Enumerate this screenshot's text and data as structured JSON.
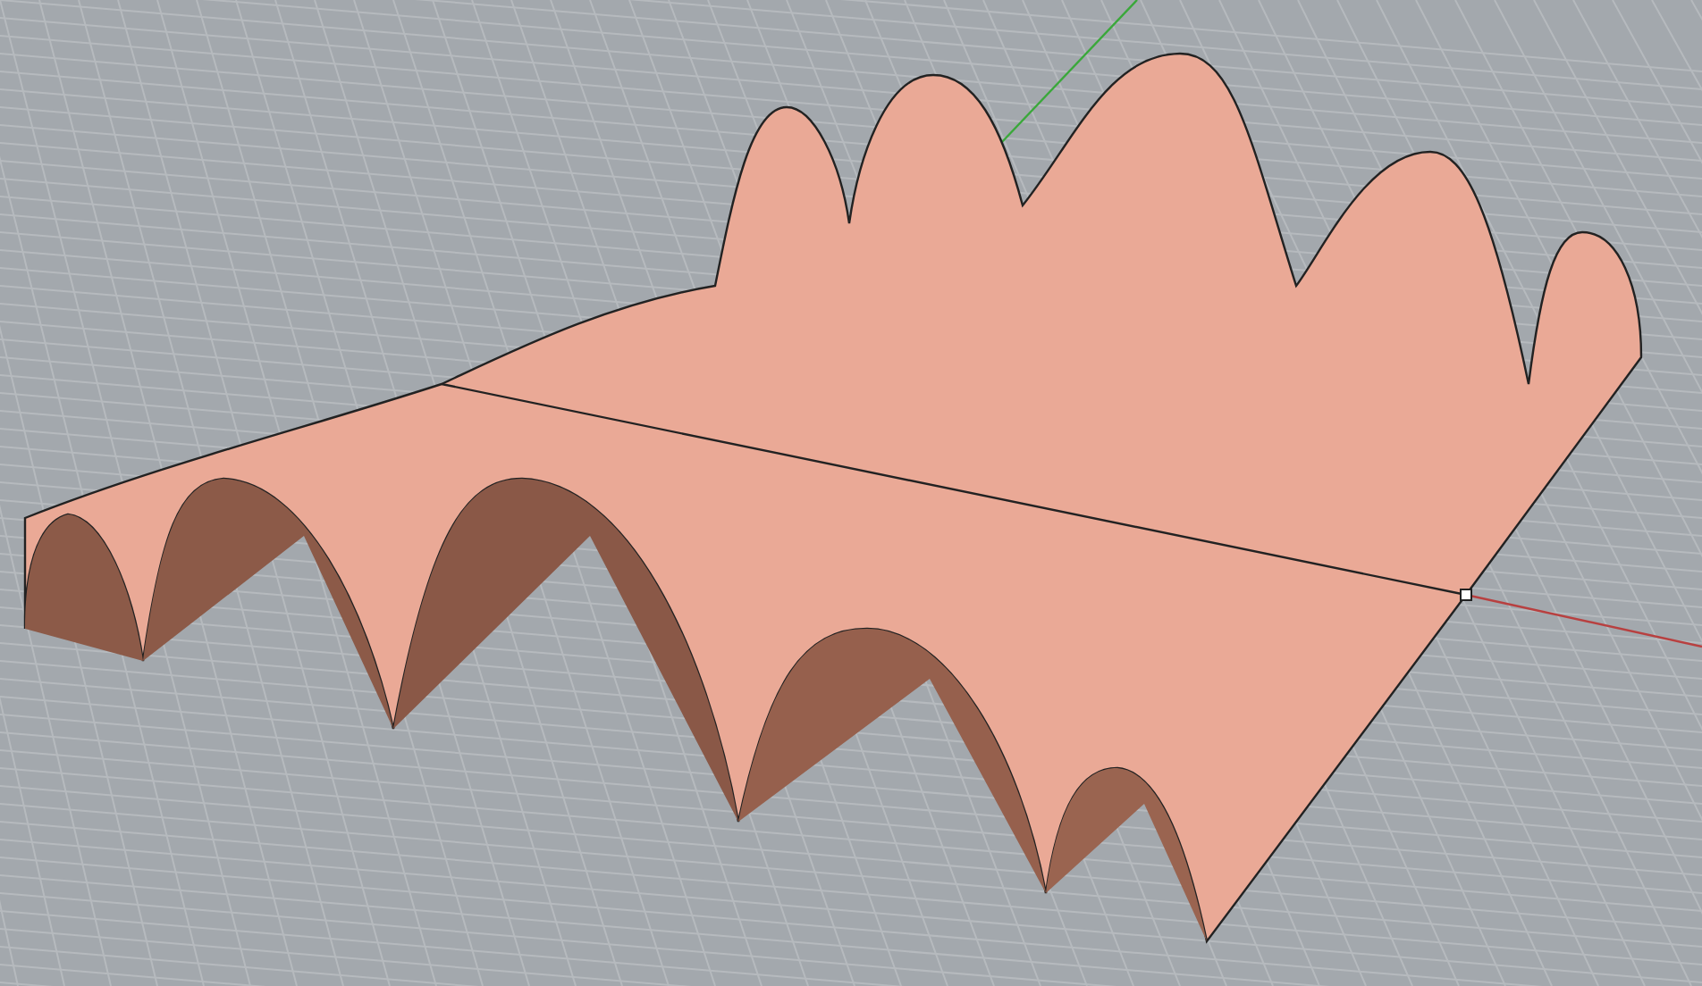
{
  "viewport": {
    "grid": true,
    "axes": true,
    "selected_point": true
  }
}
